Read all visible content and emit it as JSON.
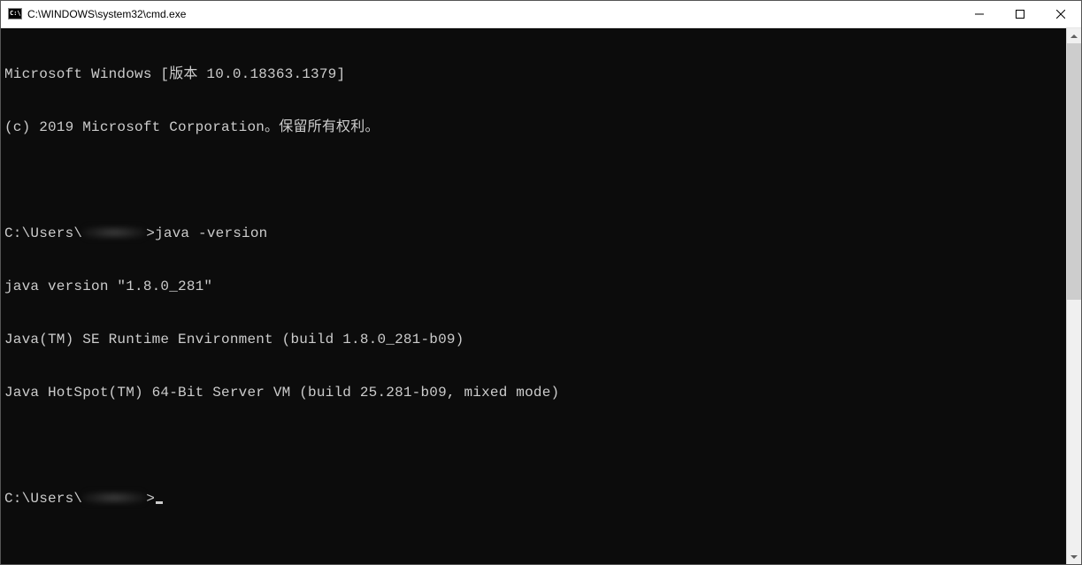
{
  "window": {
    "title": "C:\\WINDOWS\\system32\\cmd.exe"
  },
  "terminal": {
    "lines": [
      "Microsoft Windows [版本 10.0.18363.1379]",
      "(c) 2019 Microsoft Corporation。保留所有权利。",
      "",
      "",
      "java version \"1.8.0_281\"",
      "Java(TM) SE Runtime Environment (build 1.8.0_281-b09)",
      "Java HotSpot(TM) 64-Bit Server VM (build 25.281-b09, mixed mode)",
      ""
    ],
    "prompt_prefix": "C:\\Users\\",
    "prompt_suffix": ">",
    "command1": "java -version"
  }
}
